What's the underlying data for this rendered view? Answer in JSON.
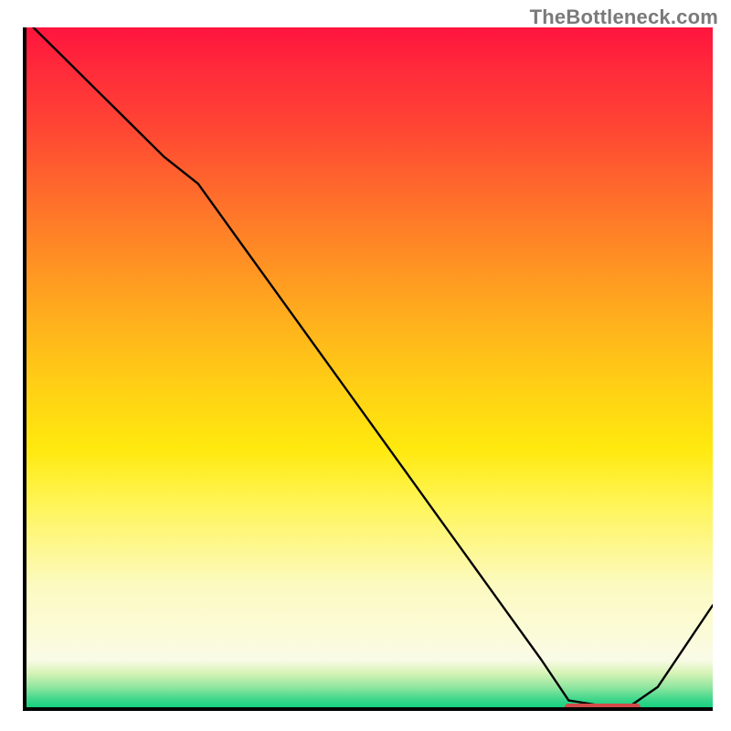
{
  "watermark": "TheBottleneck.com",
  "chart_data": {
    "type": "line",
    "title": "",
    "xlabel": "",
    "ylabel": "",
    "xlim": [
      0,
      100
    ],
    "ylim": [
      0,
      100
    ],
    "grid": false,
    "series": [
      {
        "name": "curve",
        "x": [
          1,
          5,
          10,
          15,
          20,
          25,
          30,
          35,
          40,
          45,
          50,
          55,
          60,
          65,
          70,
          75,
          79,
          84,
          88,
          92,
          96,
          100
        ],
        "y": [
          100,
          96,
          91,
          86,
          81,
          77,
          70,
          63,
          56,
          49,
          42,
          35,
          28,
          21,
          14,
          7,
          1,
          0.2,
          0.2,
          3,
          9,
          15
        ]
      }
    ],
    "annotations": [
      {
        "name": "minimum-marker",
        "x_start": 78,
        "x_end": 89,
        "y": 0.5,
        "color": "#d24a4a"
      }
    ],
    "background_gradient": {
      "top": "#ff143e",
      "mid": "#ffe90e",
      "bottom": "#16d07e"
    }
  }
}
